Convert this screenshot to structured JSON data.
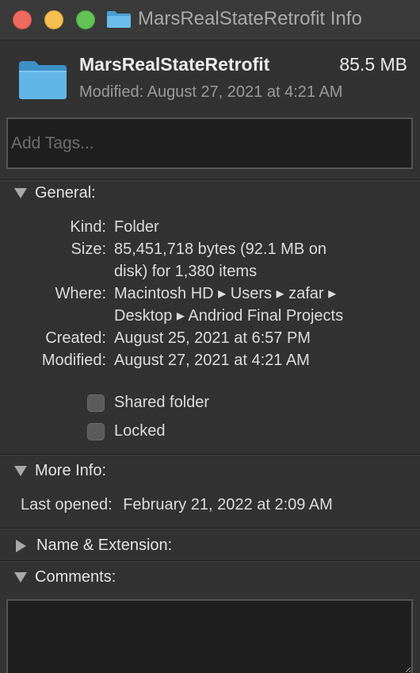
{
  "window": {
    "title": "MarsRealStateRetrofit Info"
  },
  "header": {
    "name": "MarsRealStateRetrofit",
    "size": "85.5 MB",
    "modified": "Modified: August 27, 2021 at 4:21 AM"
  },
  "tags": {
    "placeholder": "Add Tags..."
  },
  "general": {
    "title": "General:",
    "kind_label": "Kind:",
    "kind_value": "Folder",
    "size_label": "Size:",
    "size_value_line1": "85,451,718 bytes (92.1 MB on",
    "size_value_line2": "disk) for 1,380 items",
    "where_label": "Where:",
    "where_value_line1": "Macintosh HD ▸ Users ▸ zafar ▸",
    "where_value_line2": "Desktop ▸ Andriod Final Projects",
    "created_label": "Created:",
    "created_value": "August 25, 2021 at 6:57 PM",
    "modified_label": "Modified:",
    "modified_value": "August 27, 2021 at 4:21 AM",
    "shared_folder": "Shared folder",
    "shared_checked": false,
    "locked": "Locked",
    "locked_checked": false
  },
  "more_info": {
    "title": "More Info:",
    "last_opened_label": "Last opened:",
    "last_opened_value": "February 21, 2022 at 2:09 AM"
  },
  "name_extension": {
    "title": "Name & Extension:"
  },
  "comments": {
    "title": "Comments:"
  },
  "colors": {
    "background": "#323232",
    "folder_blue": "#5fb3e4",
    "close": "#ed6a5e",
    "minimize": "#f4bf4f",
    "zoom": "#61c454"
  }
}
